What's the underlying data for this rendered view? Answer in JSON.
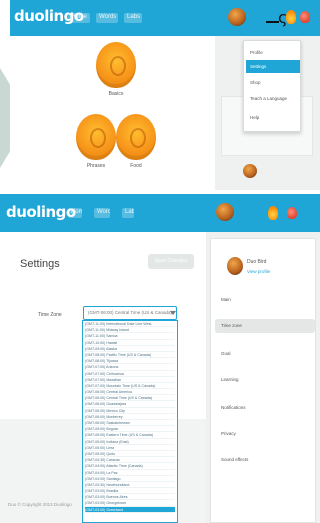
{
  "brand": {
    "logo": "duolingo",
    "primary": "#1fa6d6",
    "skill_orange": "#f7961b"
  },
  "top": {
    "nav_links": [
      "Home",
      "Words",
      "Labs"
    ],
    "skills": [
      {
        "label": "Basics"
      },
      {
        "label": "Phrases"
      },
      {
        "label": "Food"
      }
    ],
    "dropdown": {
      "items": [
        "Profile",
        "Settings",
        "Shop",
        "Teach a Language",
        "Help"
      ],
      "active_index": 1
    }
  },
  "bottom": {
    "nav_links": [
      "Home",
      "Words",
      "Labs"
    ],
    "title": "Settings",
    "save_label": "Save Changes",
    "field_label": "Time Zone",
    "selected_value": "(GMT-06:00) Central Time (US & Canada)",
    "timezones": [
      "(GMT-11:00) International Date Line West",
      "(GMT-11:00) Midway Island",
      "(GMT-11:00) Samoa",
      "(GMT-10:00) Hawaii",
      "(GMT-09:00) Alaska",
      "(GMT-08:00) Pacific Time (US & Canada)",
      "(GMT-08:00) Tijuana",
      "(GMT-07:00) Arizona",
      "(GMT-07:00) Chihuahua",
      "(GMT-07:00) Mazatlan",
      "(GMT-07:00) Mountain Time (US & Canada)",
      "(GMT-06:00) Central America",
      "(GMT-06:00) Central Time (US & Canada)",
      "(GMT-06:00) Guadalajara",
      "(GMT-06:00) Mexico City",
      "(GMT-06:00) Monterrey",
      "(GMT-06:00) Saskatchewan",
      "(GMT-05:00) Bogota",
      "(GMT-05:00) Eastern Time (US & Canada)",
      "(GMT-05:00) Indiana (East)",
      "(GMT-05:00) Lima",
      "(GMT-05:00) Quito",
      "(GMT-04:30) Caracas",
      "(GMT-04:00) Atlantic Time (Canada)",
      "(GMT-04:00) La Paz",
      "(GMT-04:00) Santiago",
      "(GMT-03:30) Newfoundland",
      "(GMT-03:00) Brasilia",
      "(GMT-03:00) Buenos Aires",
      "(GMT-03:00) Georgetown",
      "(GMT-03:00) Greenland"
    ],
    "selected_index": 30,
    "copyright": "Duo © Copyright 2013 Duolingo",
    "sidebar": {
      "profile_name": "Duo Bird",
      "profile_link": "View profile",
      "menu": [
        "Main",
        "Time zone",
        "Goal",
        "Learning",
        "Notifications",
        "Privacy",
        "Sound effects"
      ],
      "active_index": 1
    }
  }
}
